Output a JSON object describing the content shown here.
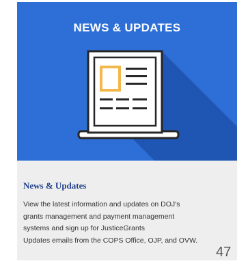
{
  "banner": {
    "title": "NEWS & UPDATES",
    "icon": "laptop-news-icon",
    "colors": {
      "background": "#2d6fd6",
      "shadow": "#1f56b4",
      "accent": "#f2b84b",
      "outline": "#262626"
    }
  },
  "card": {
    "heading": "News & Updates",
    "body_lines": [
      "View the latest information and updates on DOJ's",
      "grants management and payment management",
      "systems and sign up for JusticeGrants",
      "Updates emails from the COPS Office, OJP, and OVW."
    ]
  },
  "page_number": "47"
}
